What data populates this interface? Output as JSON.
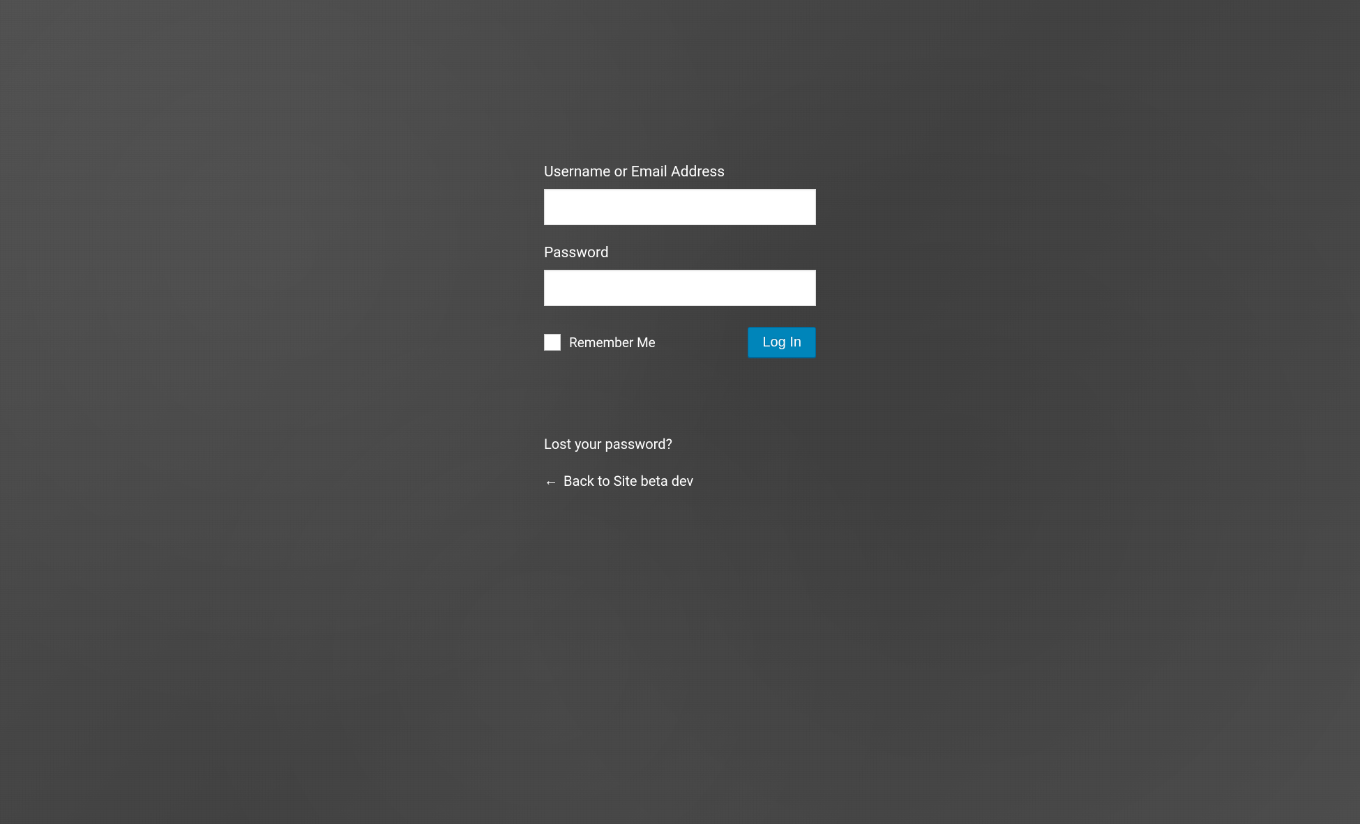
{
  "form": {
    "username_label": "Username or Email Address",
    "username_value": "",
    "password_label": "Password",
    "password_value": "",
    "remember_label": "Remember Me",
    "submit_label": "Log In"
  },
  "links": {
    "lost_password": "Lost your password?",
    "back_arrow": "←",
    "back_text": "Back to Site beta dev"
  },
  "colors": {
    "button_bg": "#0085ba",
    "text": "#ffffff",
    "input_bg": "#ffffff"
  }
}
